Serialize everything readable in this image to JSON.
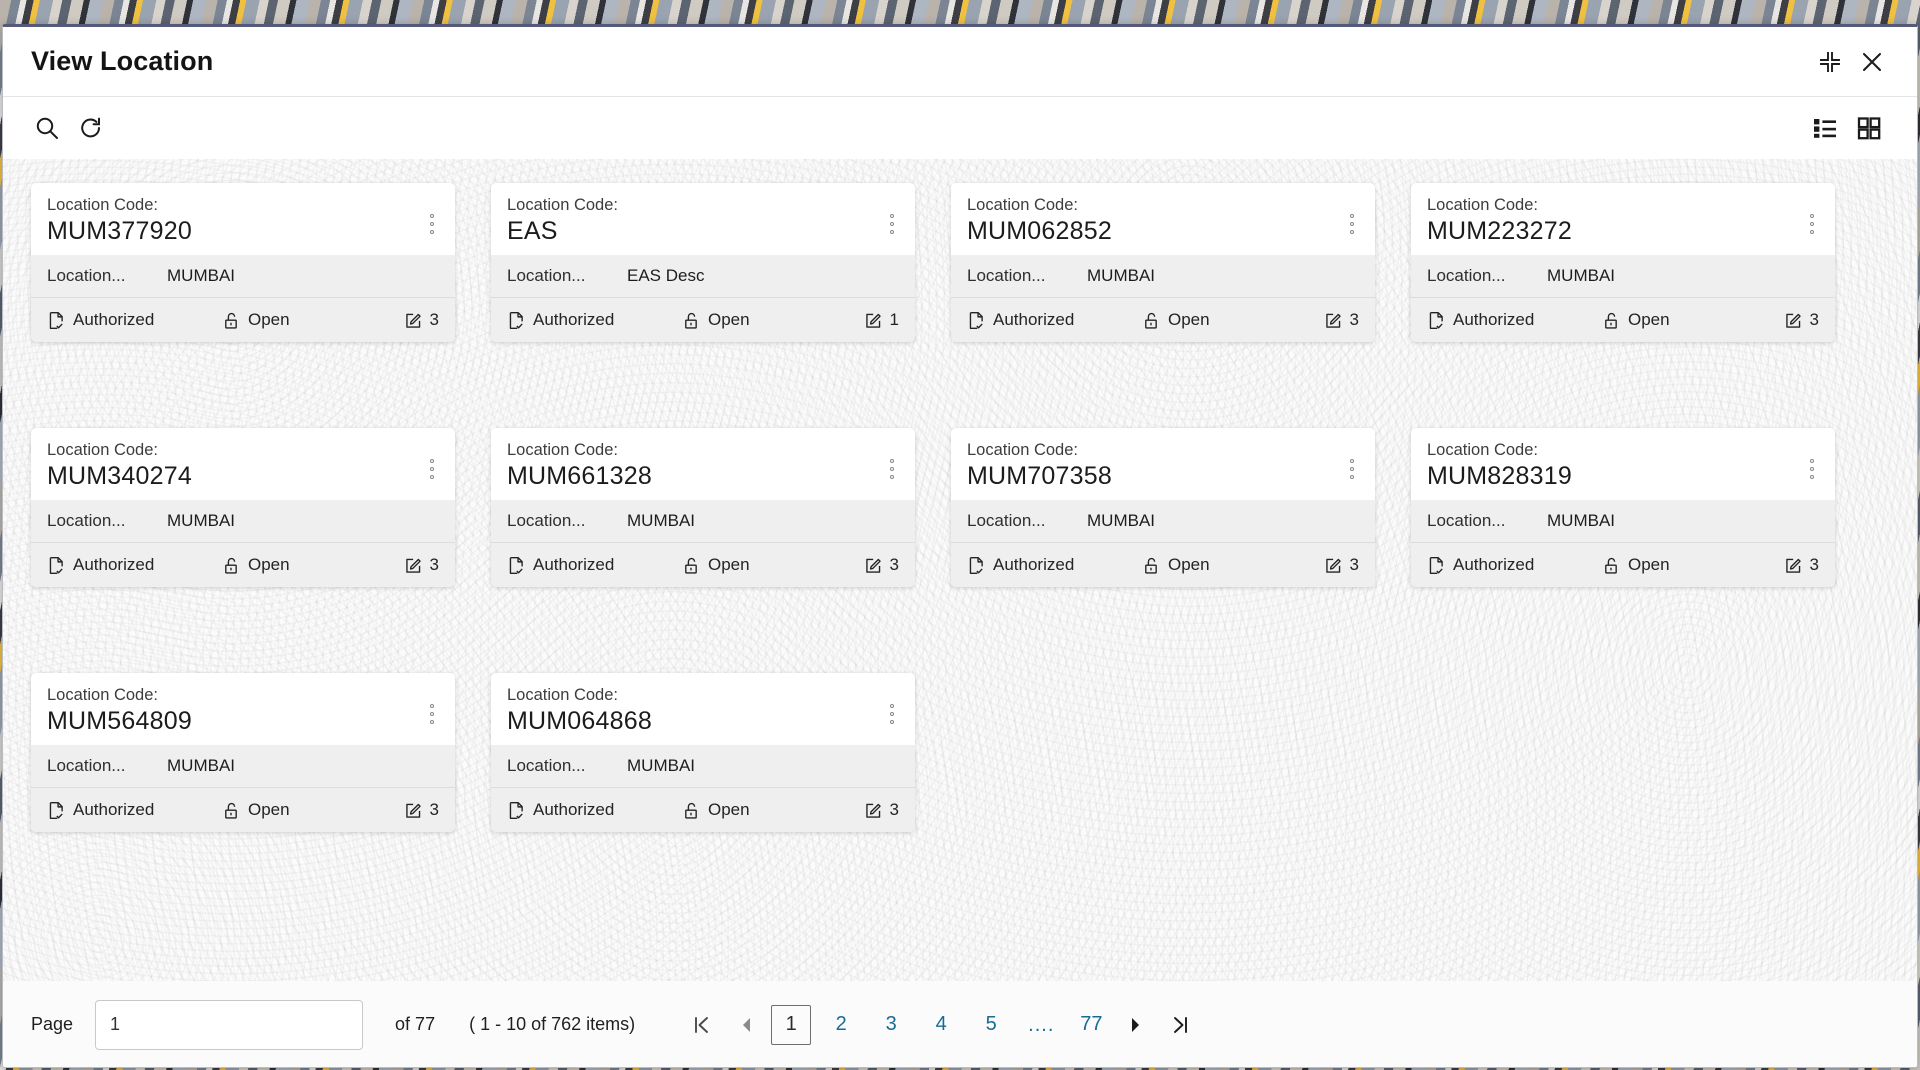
{
  "window": {
    "title": "View Location",
    "collapse_icon": "collapse-icon",
    "close_icon": "close-icon"
  },
  "toolbar": {
    "search_icon": "search-icon",
    "refresh_icon": "refresh-icon",
    "list_view_icon": "list-view-icon",
    "grid_view_icon": "grid-view-icon"
  },
  "card_labels": {
    "code_label": "Location Code:",
    "desc_label": "Location...",
    "status_icon": "document-check-icon",
    "lock_icon": "unlock-icon",
    "count_icon": "edit-square-icon",
    "menu_icon": "kebab-menu-icon"
  },
  "cards": [
    {
      "code": "MUM377920",
      "description": "MUMBAI",
      "status": "Authorized",
      "lock": "Open",
      "count": "3"
    },
    {
      "code": "EAS",
      "description": "EAS Desc",
      "status": "Authorized",
      "lock": "Open",
      "count": "1"
    },
    {
      "code": "MUM062852",
      "description": "MUMBAI",
      "status": "Authorized",
      "lock": "Open",
      "count": "3"
    },
    {
      "code": "MUM223272",
      "description": "MUMBAI",
      "status": "Authorized",
      "lock": "Open",
      "count": "3"
    },
    {
      "code": "MUM340274",
      "description": "MUMBAI",
      "status": "Authorized",
      "lock": "Open",
      "count": "3"
    },
    {
      "code": "MUM661328",
      "description": "MUMBAI",
      "status": "Authorized",
      "lock": "Open",
      "count": "3"
    },
    {
      "code": "MUM707358",
      "description": "MUMBAI",
      "status": "Authorized",
      "lock": "Open",
      "count": "3"
    },
    {
      "code": "MUM828319",
      "description": "MUMBAI",
      "status": "Authorized",
      "lock": "Open",
      "count": "3"
    },
    {
      "code": "MUM564809",
      "description": "MUMBAI",
      "status": "Authorized",
      "lock": "Open",
      "count": "3"
    },
    {
      "code": "MUM064868",
      "description": "MUMBAI",
      "status": "Authorized",
      "lock": "Open",
      "count": "3"
    }
  ],
  "pagination": {
    "page_label": "Page",
    "page_value": "1",
    "page_placeholder": "",
    "of_text": "of 77",
    "items_text": "( 1 - 10 of 762 items)",
    "first_icon": "first-page-icon",
    "prev_icon": "previous-page-icon",
    "next_icon": "next-page-icon",
    "last_icon": "last-page-icon",
    "pages": [
      {
        "label": "1",
        "active": true,
        "ellipsis": false
      },
      {
        "label": "2",
        "active": false,
        "ellipsis": false
      },
      {
        "label": "3",
        "active": false,
        "ellipsis": false
      },
      {
        "label": "4",
        "active": false,
        "ellipsis": false
      },
      {
        "label": "5",
        "active": false,
        "ellipsis": false
      },
      {
        "label": "....",
        "active": false,
        "ellipsis": true
      },
      {
        "label": "77",
        "active": false,
        "ellipsis": false
      }
    ]
  },
  "colors": {
    "link": "#1a6b94",
    "title": "#141414",
    "card_body": "#efefef",
    "accent_border": "#555a7a"
  }
}
